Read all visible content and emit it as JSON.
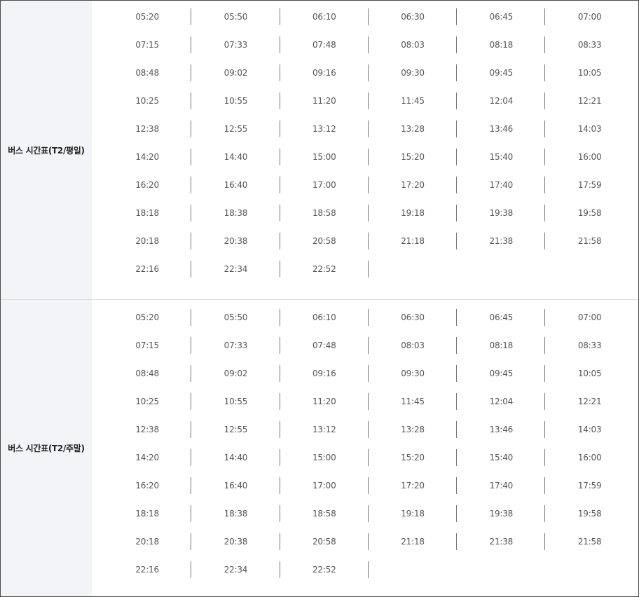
{
  "timetables": [
    {
      "label": "버스 시간표(T2/평일)",
      "rows": [
        [
          "05:20",
          "05:50",
          "06:10",
          "06:30",
          "06:45",
          "07:00"
        ],
        [
          "07:15",
          "07:33",
          "07:48",
          "08:03",
          "08:18",
          "08:33"
        ],
        [
          "08:48",
          "09:02",
          "09:16",
          "09:30",
          "09:45",
          "10:05"
        ],
        [
          "10:25",
          "10:55",
          "11:20",
          "11:45",
          "12:04",
          "12:21"
        ],
        [
          "12:38",
          "12:55",
          "13:12",
          "13:28",
          "13:46",
          "14:03"
        ],
        [
          "14:20",
          "14:40",
          "15:00",
          "15:20",
          "15:40",
          "16:00"
        ],
        [
          "16:20",
          "16:40",
          "17:00",
          "17:20",
          "17:40",
          "17:59"
        ],
        [
          "18:18",
          "18:38",
          "18:58",
          "19:18",
          "19:38",
          "19:58"
        ],
        [
          "20:18",
          "20:38",
          "20:58",
          "21:18",
          "21:38",
          "21:58"
        ],
        [
          "22:16",
          "22:34",
          "22:52"
        ]
      ]
    },
    {
      "label": "버스 시간표(T2/주말)",
      "rows": [
        [
          "05:20",
          "05:50",
          "06:10",
          "06:30",
          "06:45",
          "07:00"
        ],
        [
          "07:15",
          "07:33",
          "07:48",
          "08:03",
          "08:18",
          "08:33"
        ],
        [
          "08:48",
          "09:02",
          "09:16",
          "09:30",
          "09:45",
          "10:05"
        ],
        [
          "10:25",
          "10:55",
          "11:20",
          "11:45",
          "12:04",
          "12:21"
        ],
        [
          "12:38",
          "12:55",
          "13:12",
          "13:28",
          "13:46",
          "14:03"
        ],
        [
          "14:20",
          "14:40",
          "15:00",
          "15:20",
          "15:40",
          "16:00"
        ],
        [
          "16:20",
          "16:40",
          "17:00",
          "17:20",
          "17:40",
          "17:59"
        ],
        [
          "18:18",
          "18:38",
          "18:58",
          "19:18",
          "19:38",
          "19:58"
        ],
        [
          "20:18",
          "20:38",
          "20:58",
          "21:18",
          "21:38",
          "21:58"
        ],
        [
          "22:16",
          "22:34",
          "22:52"
        ]
      ]
    }
  ]
}
